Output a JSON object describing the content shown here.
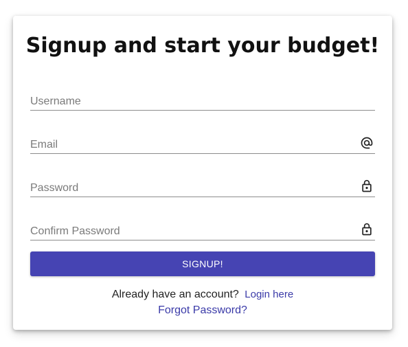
{
  "form": {
    "title": "Signup and start your budget!",
    "fields": {
      "username": {
        "placeholder": "Username",
        "value": ""
      },
      "email": {
        "placeholder": "Email",
        "value": "",
        "icon": "at-sign-icon"
      },
      "password": {
        "placeholder": "Password",
        "value": "",
        "icon": "lock-icon"
      },
      "confirm_password": {
        "placeholder": "Confirm Password",
        "value": "",
        "icon": "lock-icon"
      }
    },
    "submit_label": "SIGNUP!",
    "already_text": "Already have an account?",
    "login_link": "Login here",
    "forgot_link": "Forgot Password?"
  },
  "colors": {
    "accent": "#4644b3",
    "link": "#3a3aa8",
    "underline": "#8c8c8c"
  }
}
